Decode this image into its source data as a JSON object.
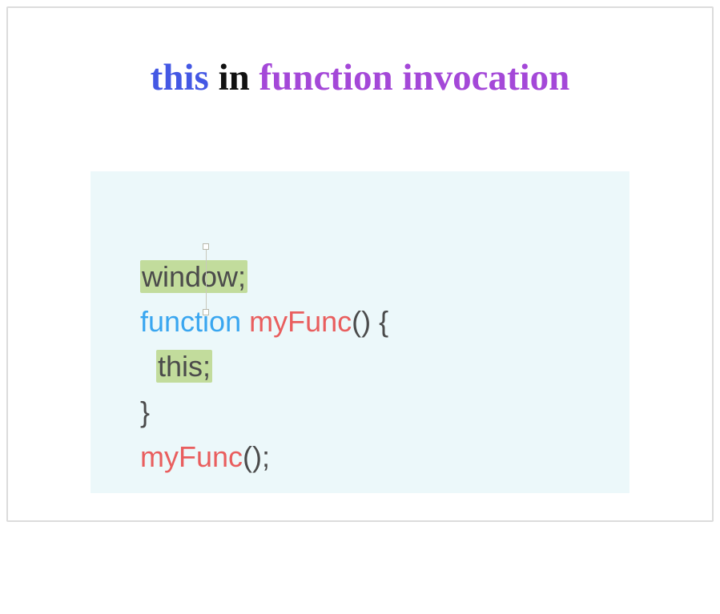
{
  "title": {
    "word_this": "this",
    "word_in": "in",
    "word_fn": "function invocation"
  },
  "code": {
    "line1_hl": "window;",
    "line2_kw": "function",
    "line2_sp": " ",
    "line2_name": "myFunc",
    "line2_rest": "() {",
    "line3_indent": "  ",
    "line3_hl": "this;",
    "line4": "}",
    "line5_name": "myFunc",
    "line5_rest": "();"
  }
}
